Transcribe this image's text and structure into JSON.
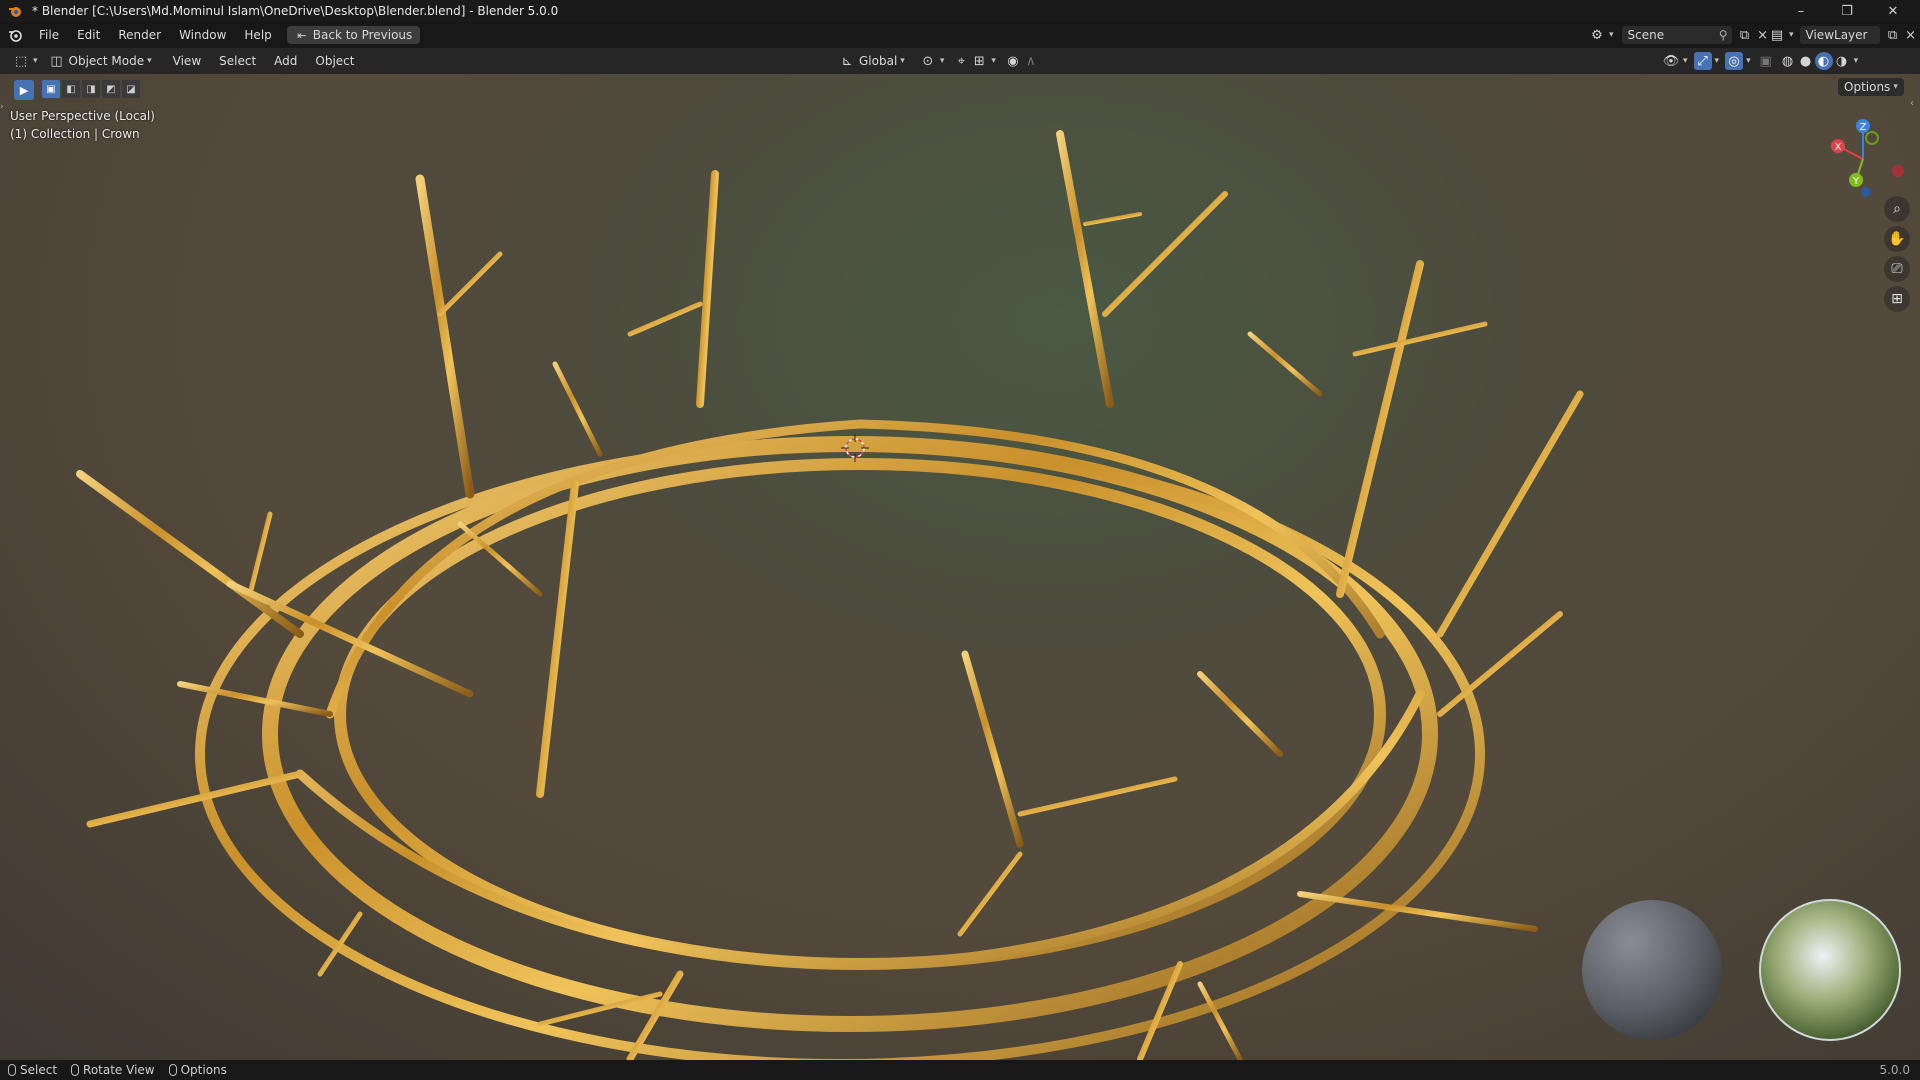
{
  "window": {
    "title": "* Blender [C:\\Users\\Md.Mominul Islam\\OneDrive\\Desktop\\Blender.blend] - Blender 5.0.0"
  },
  "menubar": {
    "items": [
      "File",
      "Edit",
      "Render",
      "Window",
      "Help"
    ],
    "back_button": "Back to Previous",
    "scene_label": "Scene",
    "viewlayer_label": "ViewLayer"
  },
  "viewport_header": {
    "mode": "Object Mode",
    "menus": [
      "View",
      "Select",
      "Add",
      "Object"
    ],
    "transform_orientation": "Global",
    "options_label": "Options"
  },
  "viewport": {
    "perspective_label": "User Perspective (Local)",
    "collection_label": "(1) Collection | Crown",
    "gizmo": {
      "x": "X",
      "y": "Y",
      "z": "Z"
    }
  },
  "statusbar": {
    "select": "Select",
    "rotate": "Rotate View",
    "options": "Options",
    "version": "5.0.0"
  },
  "icons": {
    "blender": "blender-logo-icon",
    "zoom": "zoom-icon",
    "pan": "hand-icon",
    "camera": "camera-icon",
    "grid": "grid-icon"
  },
  "colors": {
    "accent": "#4772b3",
    "axis_x": "#e0424a",
    "axis_y": "#7fbd1f",
    "axis_z": "#3d82e0",
    "gold": "#d9a23a"
  }
}
